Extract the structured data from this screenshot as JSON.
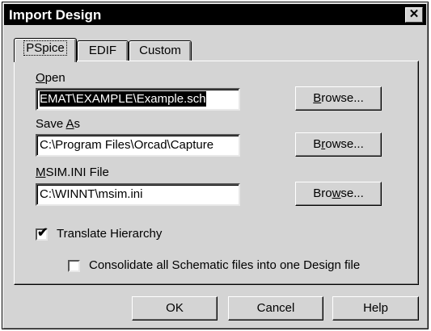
{
  "window": {
    "title": "Import Design",
    "close_glyph": "✕"
  },
  "tabs": [
    {
      "label": "PSpice",
      "active": true
    },
    {
      "label": "EDIF",
      "active": false
    },
    {
      "label": "Custom",
      "active": false
    }
  ],
  "open": {
    "label_mnemonic": "O",
    "label_rest": "pen",
    "value": "EMAT\\EXAMPLE\\Example.sch",
    "browse_pre": "",
    "browse_mn": "B",
    "browse_post": "rowse..."
  },
  "save_as": {
    "label_pre": "Save ",
    "label_mnemonic": "A",
    "label_rest": "s",
    "value": "C:\\Program Files\\Orcad\\Capture",
    "browse_pre": "B",
    "browse_mn": "r",
    "browse_post": "owse..."
  },
  "msim": {
    "label_mnemonic": "M",
    "label_rest": "SIM.INI File",
    "value": "C:\\WINNT\\msim.ini",
    "browse_pre": "Bro",
    "browse_mn": "w",
    "browse_post": "se..."
  },
  "translate_hierarchy": {
    "label": "Translate Hierarchy",
    "checked": true,
    "mark": "✔"
  },
  "consolidate": {
    "label": "Consolidate all Schematic files into one Design file",
    "checked": false
  },
  "footer": {
    "ok_label": "OK",
    "cancel_label": "Cancel",
    "help_label": "Help"
  }
}
